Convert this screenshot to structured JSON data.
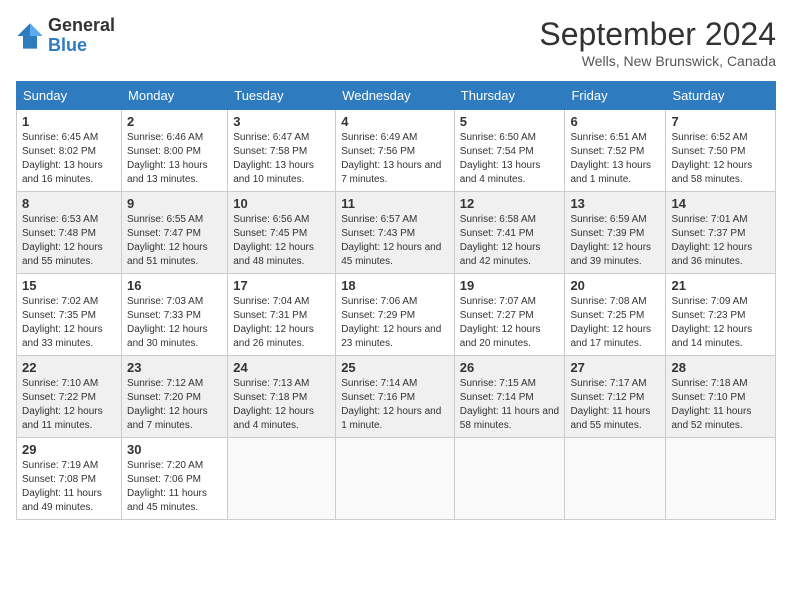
{
  "header": {
    "logo_line1": "General",
    "logo_line2": "Blue",
    "month_title": "September 2024",
    "location": "Wells, New Brunswick, Canada"
  },
  "days_of_week": [
    "Sunday",
    "Monday",
    "Tuesday",
    "Wednesday",
    "Thursday",
    "Friday",
    "Saturday"
  ],
  "weeks": [
    [
      {
        "day": "1",
        "info": "Sunrise: 6:45 AM\nSunset: 8:02 PM\nDaylight: 13 hours and 16 minutes."
      },
      {
        "day": "2",
        "info": "Sunrise: 6:46 AM\nSunset: 8:00 PM\nDaylight: 13 hours and 13 minutes."
      },
      {
        "day": "3",
        "info": "Sunrise: 6:47 AM\nSunset: 7:58 PM\nDaylight: 13 hours and 10 minutes."
      },
      {
        "day": "4",
        "info": "Sunrise: 6:49 AM\nSunset: 7:56 PM\nDaylight: 13 hours and 7 minutes."
      },
      {
        "day": "5",
        "info": "Sunrise: 6:50 AM\nSunset: 7:54 PM\nDaylight: 13 hours and 4 minutes."
      },
      {
        "day": "6",
        "info": "Sunrise: 6:51 AM\nSunset: 7:52 PM\nDaylight: 13 hours and 1 minute."
      },
      {
        "day": "7",
        "info": "Sunrise: 6:52 AM\nSunset: 7:50 PM\nDaylight: 12 hours and 58 minutes."
      }
    ],
    [
      {
        "day": "8",
        "info": "Sunrise: 6:53 AM\nSunset: 7:48 PM\nDaylight: 12 hours and 55 minutes."
      },
      {
        "day": "9",
        "info": "Sunrise: 6:55 AM\nSunset: 7:47 PM\nDaylight: 12 hours and 51 minutes."
      },
      {
        "day": "10",
        "info": "Sunrise: 6:56 AM\nSunset: 7:45 PM\nDaylight: 12 hours and 48 minutes."
      },
      {
        "day": "11",
        "info": "Sunrise: 6:57 AM\nSunset: 7:43 PM\nDaylight: 12 hours and 45 minutes."
      },
      {
        "day": "12",
        "info": "Sunrise: 6:58 AM\nSunset: 7:41 PM\nDaylight: 12 hours and 42 minutes."
      },
      {
        "day": "13",
        "info": "Sunrise: 6:59 AM\nSunset: 7:39 PM\nDaylight: 12 hours and 39 minutes."
      },
      {
        "day": "14",
        "info": "Sunrise: 7:01 AM\nSunset: 7:37 PM\nDaylight: 12 hours and 36 minutes."
      }
    ],
    [
      {
        "day": "15",
        "info": "Sunrise: 7:02 AM\nSunset: 7:35 PM\nDaylight: 12 hours and 33 minutes."
      },
      {
        "day": "16",
        "info": "Sunrise: 7:03 AM\nSunset: 7:33 PM\nDaylight: 12 hours and 30 minutes."
      },
      {
        "day": "17",
        "info": "Sunrise: 7:04 AM\nSunset: 7:31 PM\nDaylight: 12 hours and 26 minutes."
      },
      {
        "day": "18",
        "info": "Sunrise: 7:06 AM\nSunset: 7:29 PM\nDaylight: 12 hours and 23 minutes."
      },
      {
        "day": "19",
        "info": "Sunrise: 7:07 AM\nSunset: 7:27 PM\nDaylight: 12 hours and 20 minutes."
      },
      {
        "day": "20",
        "info": "Sunrise: 7:08 AM\nSunset: 7:25 PM\nDaylight: 12 hours and 17 minutes."
      },
      {
        "day": "21",
        "info": "Sunrise: 7:09 AM\nSunset: 7:23 PM\nDaylight: 12 hours and 14 minutes."
      }
    ],
    [
      {
        "day": "22",
        "info": "Sunrise: 7:10 AM\nSunset: 7:22 PM\nDaylight: 12 hours and 11 minutes."
      },
      {
        "day": "23",
        "info": "Sunrise: 7:12 AM\nSunset: 7:20 PM\nDaylight: 12 hours and 7 minutes."
      },
      {
        "day": "24",
        "info": "Sunrise: 7:13 AM\nSunset: 7:18 PM\nDaylight: 12 hours and 4 minutes."
      },
      {
        "day": "25",
        "info": "Sunrise: 7:14 AM\nSunset: 7:16 PM\nDaylight: 12 hours and 1 minute."
      },
      {
        "day": "26",
        "info": "Sunrise: 7:15 AM\nSunset: 7:14 PM\nDaylight: 11 hours and 58 minutes."
      },
      {
        "day": "27",
        "info": "Sunrise: 7:17 AM\nSunset: 7:12 PM\nDaylight: 11 hours and 55 minutes."
      },
      {
        "day": "28",
        "info": "Sunrise: 7:18 AM\nSunset: 7:10 PM\nDaylight: 11 hours and 52 minutes."
      }
    ],
    [
      {
        "day": "29",
        "info": "Sunrise: 7:19 AM\nSunset: 7:08 PM\nDaylight: 11 hours and 49 minutes."
      },
      {
        "day": "30",
        "info": "Sunrise: 7:20 AM\nSunset: 7:06 PM\nDaylight: 11 hours and 45 minutes."
      },
      {
        "day": "",
        "info": ""
      },
      {
        "day": "",
        "info": ""
      },
      {
        "day": "",
        "info": ""
      },
      {
        "day": "",
        "info": ""
      },
      {
        "day": "",
        "info": ""
      }
    ]
  ]
}
